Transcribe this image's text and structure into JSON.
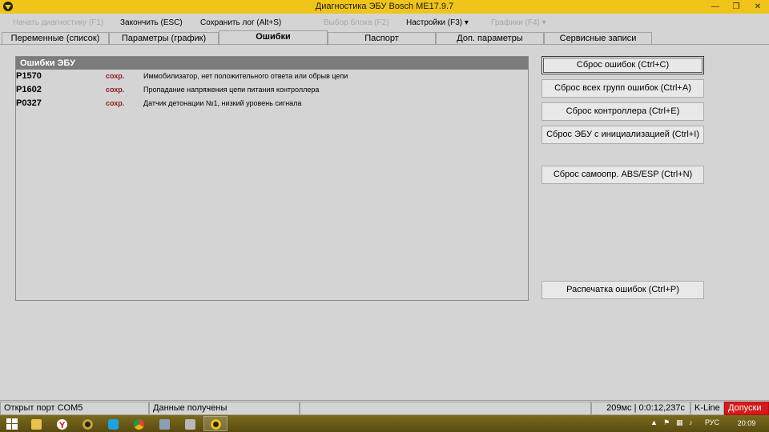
{
  "window": {
    "title": "Диагностика ЭБУ Bosch ME17.9.7",
    "minimize_glyph": "—",
    "maximize_glyph": "❐",
    "close_glyph": "✕",
    "titlebar_color": "#f0c419"
  },
  "menu": {
    "start_diag": "Начать диагностику (F1)",
    "finish": "Закончить (ESC)",
    "save_log": "Сохранить лог (Alt+S)",
    "select_block": "Выбор блока (F2)",
    "settings": "Настройки (F3) ▾",
    "graphs": "Графики (F4) ▾"
  },
  "tabs": [
    {
      "label": "Переменные (список)"
    },
    {
      "label": "Параметры (график)"
    },
    {
      "label": "Ошибки",
      "active": true
    },
    {
      "label": "Паспорт"
    },
    {
      "label": "Доп. параметры"
    },
    {
      "label": "Сервисные записи"
    }
  ],
  "errors_panel": {
    "header": "Ошибки ЭБУ",
    "rows": [
      {
        "code": "P1570",
        "state": "сохр.",
        "description": "Иммобилизатор, нет положительного ответа или обрыв цепи"
      },
      {
        "code": "P1602",
        "state": "сохр.",
        "description": "Пропадание напряжения цепи питания контроллера"
      },
      {
        "code": "P0327",
        "state": "сохр.",
        "description": "Датчик детонации №1, низкий уровень сигнала"
      }
    ]
  },
  "buttons": {
    "reset_errors": "Сброс ошибок (Ctrl+C)",
    "reset_all_groups": "Сброс всех групп ошибок (Ctrl+A)",
    "reset_controller": "Сброс контроллера (Ctrl+E)",
    "reset_ecu_init": "Сброс ЭБУ с инициализацией (Ctrl+I)",
    "reset_abs_esp": "Сброс самоопр. ABS/ESP (Ctrl+N)",
    "print_errors": "Распечатка ошибок (Ctrl+P)"
  },
  "status": {
    "port": "Открыт порт COM5",
    "data": "Данные получены",
    "empty": "",
    "timing": "209мс | 0:0:12,237с",
    "protocol": "K-Line",
    "tolerances": "Допуски",
    "tolerances_color": "#d41a1a"
  },
  "taskbar": {
    "apps": [
      "file-explorer-icon",
      "yandex-browser-icon",
      "media-player-icon",
      "skype-icon",
      "chrome-icon",
      "network-tool-icon",
      "scanner-icon",
      "diagnostics-app-icon"
    ],
    "language": "РУС",
    "clock": "20:09"
  }
}
